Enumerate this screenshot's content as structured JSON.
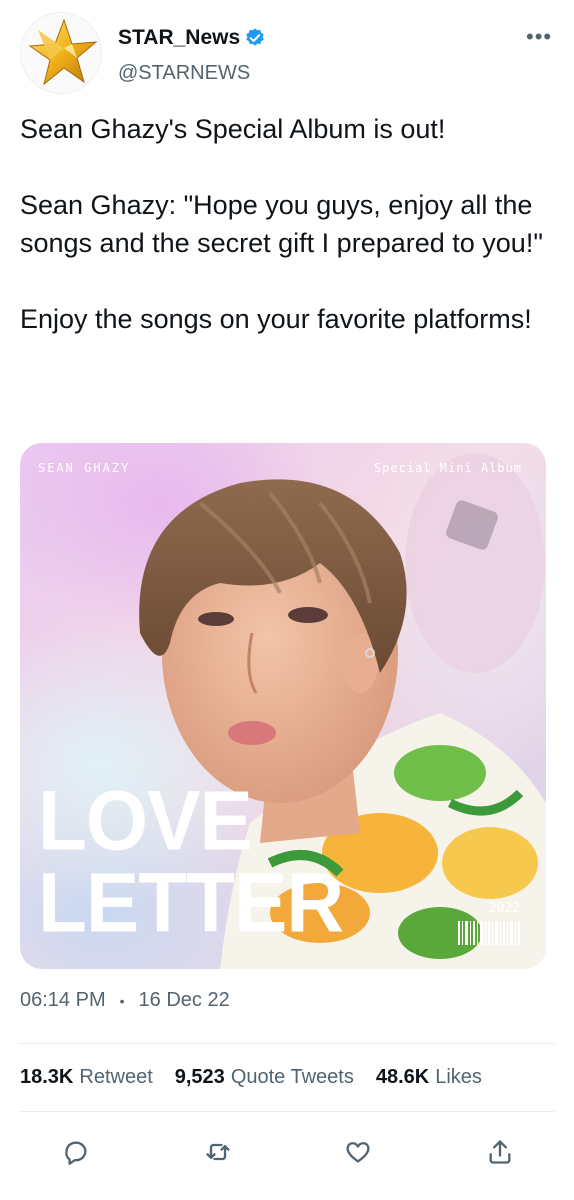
{
  "account": {
    "display_name": "STAR_News",
    "handle": "@STARNEWS",
    "verified": true,
    "avatar_icon": "gold-star-logo-icon",
    "more_label": "•••"
  },
  "tweet": {
    "paragraphs": [
      "Sean Ghazy's Special Album is out!",
      "Sean Ghazy: \"Hope you guys, enjoy all the songs and the secret gift I prepared to you!\"",
      "Enjoy the songs on your favorite platforms!"
    ]
  },
  "media": {
    "artist": "SEAN GHAZY",
    "album_type": "Special Mini Album",
    "title_line1": "LOVE",
    "title_line2": "LETTER",
    "year": "2022"
  },
  "meta": {
    "time": "06:14 PM",
    "separator": "•",
    "date": "16 Dec 22"
  },
  "stats": {
    "retweets": {
      "count": "18.3K",
      "label": "Retweet"
    },
    "quotes": {
      "count": "9,523",
      "label": "Quote Tweets"
    },
    "likes": {
      "count": "48.6K",
      "label": "Likes"
    }
  },
  "actions": [
    {
      "name": "reply",
      "icon": "reply-icon"
    },
    {
      "name": "retweet",
      "icon": "retweet-icon"
    },
    {
      "name": "like",
      "icon": "heart-icon"
    },
    {
      "name": "share",
      "icon": "share-icon"
    }
  ],
  "colors": {
    "text": "#0f1419",
    "secondary": "#536471",
    "verified": "#1d9bf0",
    "divider": "#e6ecf0"
  }
}
